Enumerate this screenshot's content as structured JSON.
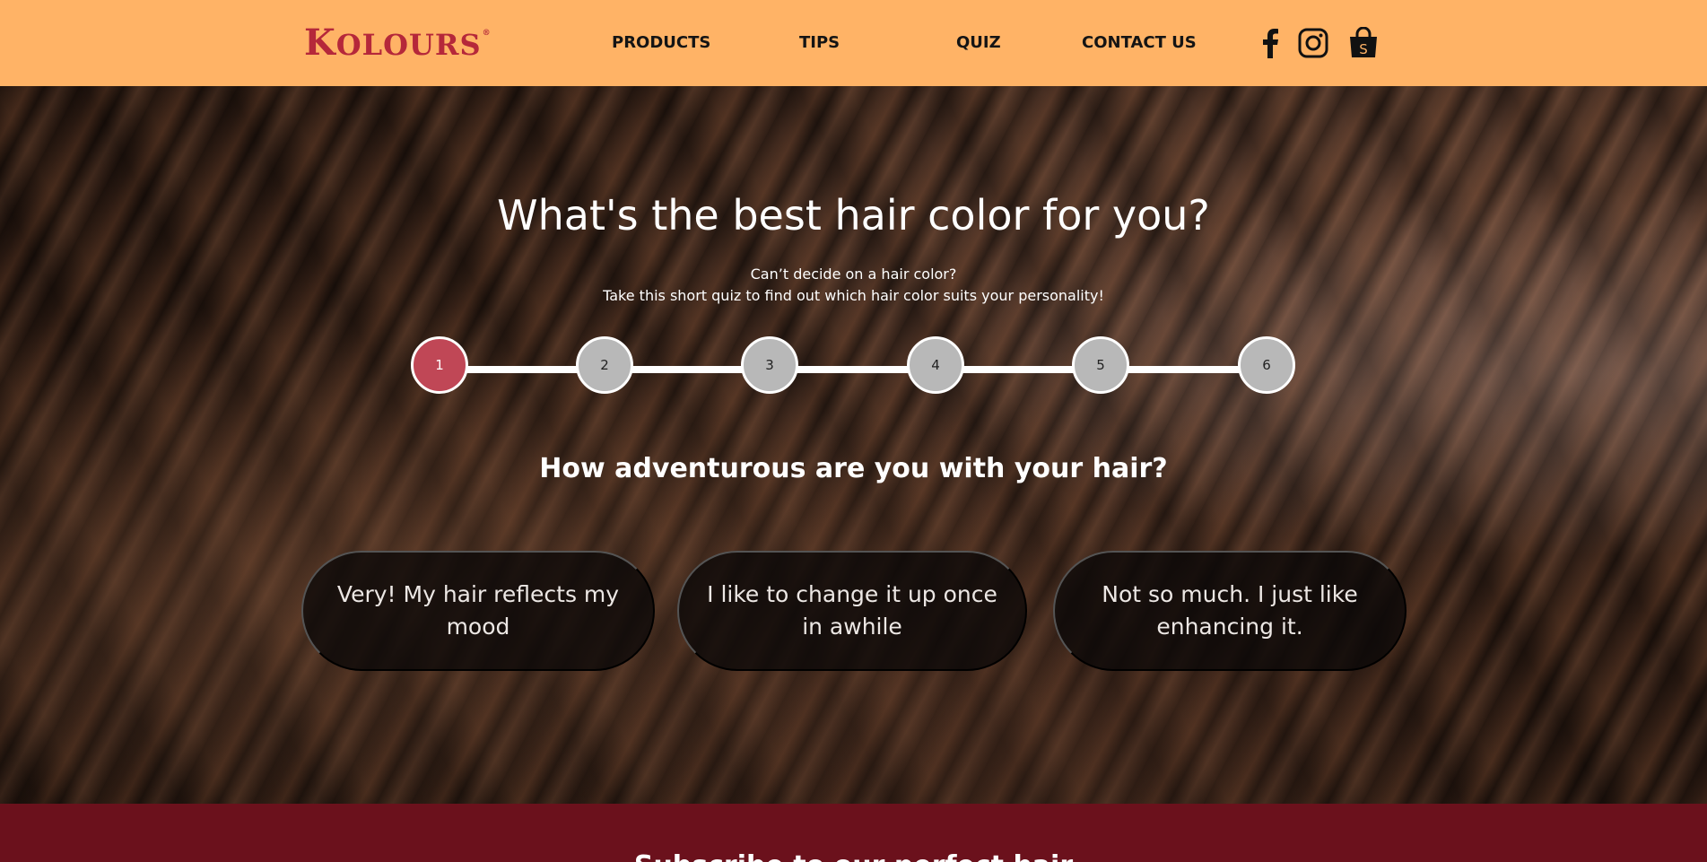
{
  "header": {
    "logo_first": "K",
    "logo_rest": "OLOURS",
    "logo_mark": "®",
    "nav": [
      {
        "label": "PRODUCTS"
      },
      {
        "label": "TIPS"
      },
      {
        "label": "QUIZ"
      },
      {
        "label": "CONTACT US"
      }
    ],
    "social": [
      {
        "icon": "facebook-icon"
      },
      {
        "icon": "instagram-icon"
      },
      {
        "icon": "shopping-bag-icon",
        "glyph": "S"
      }
    ]
  },
  "colors": {
    "header_bg": "#ffb366",
    "logo": "#b5283a",
    "step_active": "#c04756",
    "step_inactive": "#b8b8b8",
    "footer_bg": "#6b111c"
  },
  "quiz": {
    "title": "What's the best hair color for you?",
    "subtitle_1": "Can’t decide on a hair color?",
    "subtitle_2": "Take this short quiz to find out which hair color suits your personality!",
    "steps": [
      "1",
      "2",
      "3",
      "4",
      "5",
      "6"
    ],
    "current_step": 1,
    "question": "How adventurous are you with your hair?",
    "answers": [
      "Very! My hair reflects my mood",
      "I like to change it up once in awhile",
      "Not so much. I just like enhancing it."
    ]
  },
  "footer": {
    "subscribe_title": "Subscribe to our perfect hair"
  }
}
